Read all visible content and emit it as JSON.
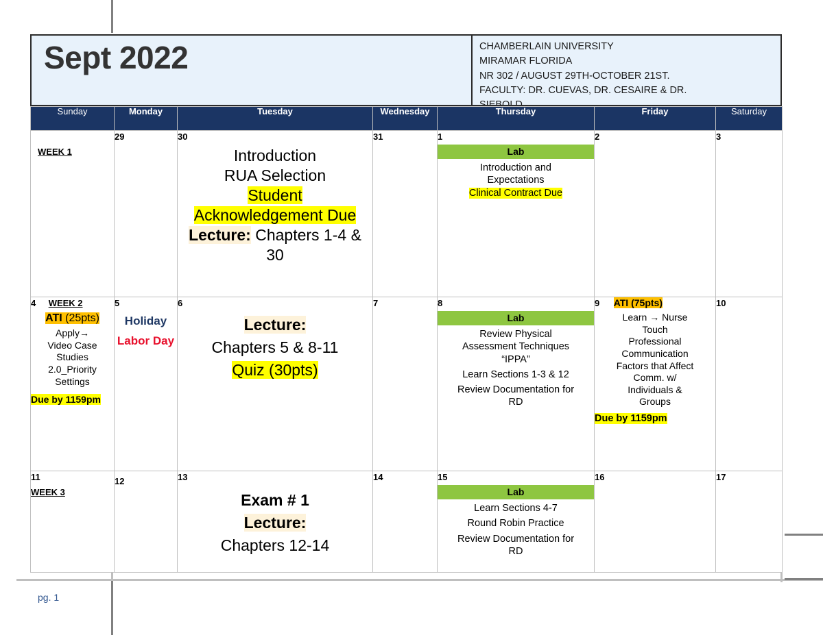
{
  "header": {
    "month_title": "Sept 2022",
    "meta_lines": [
      "CHAMBERLAIN UNIVERSITY",
      "MIRAMAR FLORIDA",
      "NR 302 / AUGUST 29TH-OCTOBER 21ST.",
      "FACULTY: DR. CUEVAS, DR. CESAIRE & DR.",
      "SIEBOLD"
    ]
  },
  "colors": {
    "header_band": "#1b3564",
    "header_box": "#e8f2fb",
    "lab_green": "#8ec641",
    "highlight_yellow": "#ffff00",
    "highlight_amber": "#ffc000",
    "highlight_cream": "#fdf2da",
    "holiday_navy": "#1f3864",
    "holiday_red": "#e8112d",
    "grid": "#bfbfbf",
    "page_number": "#31568f"
  },
  "weekdays": [
    {
      "label": "Sunday",
      "weekend": true
    },
    {
      "label": "Monday",
      "weekend": false
    },
    {
      "label": "Tuesday",
      "weekend": false
    },
    {
      "label": "Wednesday",
      "weekend": false
    },
    {
      "label": "Thursday",
      "weekend": false
    },
    {
      "label": "Friday",
      "weekend": false
    },
    {
      "label": "Saturday",
      "weekend": true
    }
  ],
  "weeks": [
    {
      "week_label": "WEEK 1",
      "sunday": {
        "daynum": ""
      },
      "monday": {
        "daynum": "29"
      },
      "tuesday": {
        "daynum": "30",
        "lines": [
          "Introduction",
          "RUA Selection",
          "Student",
          "Acknowledgement Due",
          "Lecture: Chapters 1-4 &",
          "30"
        ]
      },
      "wednesday": {
        "daynum": "31"
      },
      "thursday": {
        "daynum": "1",
        "lab": "Lab",
        "lines": [
          "Introduction and",
          "Expectations",
          "Clinical Contract Due"
        ]
      },
      "friday": {
        "daynum": "2"
      },
      "saturday": {
        "daynum": "3"
      }
    },
    {
      "week_label": "WEEK 2",
      "sunday": {
        "daynum": "4",
        "ati": "ATI",
        "ati_pts": "(25pts)",
        "lines": [
          "Apply→",
          "Video Case",
          "Studies",
          "2.0_Priority",
          "Settings"
        ],
        "due": "Due by 1159pm"
      },
      "monday": {
        "daynum": "5",
        "holiday": "Holiday",
        "holiday_name": "Labor Day"
      },
      "tuesday": {
        "daynum": "6",
        "lines": [
          "Lecture:",
          "Chapters 5 & 8-11",
          "Quiz (30pts)"
        ]
      },
      "wednesday": {
        "daynum": "7"
      },
      "thursday": {
        "daynum": "8",
        "lab": "Lab",
        "lines": [
          "Review Physical",
          "Assessment Techniques",
          "“IPPA”",
          "Learn Sections 1-3 & 12",
          "Review Documentation for",
          "RD"
        ]
      },
      "friday": {
        "daynum": "9",
        "ati": "ATI (75pts)",
        "lines": [
          "Learn → Nurse",
          "Touch",
          "Professional",
          "Communication",
          "Factors that Affect",
          "Comm. w/",
          "Individuals &",
          "Groups"
        ],
        "due": "Due by 1159pm"
      },
      "saturday": {
        "daynum": "10"
      }
    },
    {
      "week_label": "WEEK 3",
      "sunday": {
        "daynum": "11"
      },
      "monday": {
        "daynum": "12"
      },
      "tuesday": {
        "daynum": "13",
        "lines": [
          "Exam # 1",
          "Lecture:",
          "Chapters 12-14"
        ]
      },
      "wednesday": {
        "daynum": "14"
      },
      "thursday": {
        "daynum": "15",
        "lab": "Lab",
        "lines": [
          "Learn Sections 4-7",
          "Round Robin Practice",
          "Review Documentation for",
          "RD"
        ]
      },
      "friday": {
        "daynum": "16"
      },
      "saturday": {
        "daynum": "17"
      }
    }
  ],
  "footer": {
    "page_label": "pg. 1"
  }
}
